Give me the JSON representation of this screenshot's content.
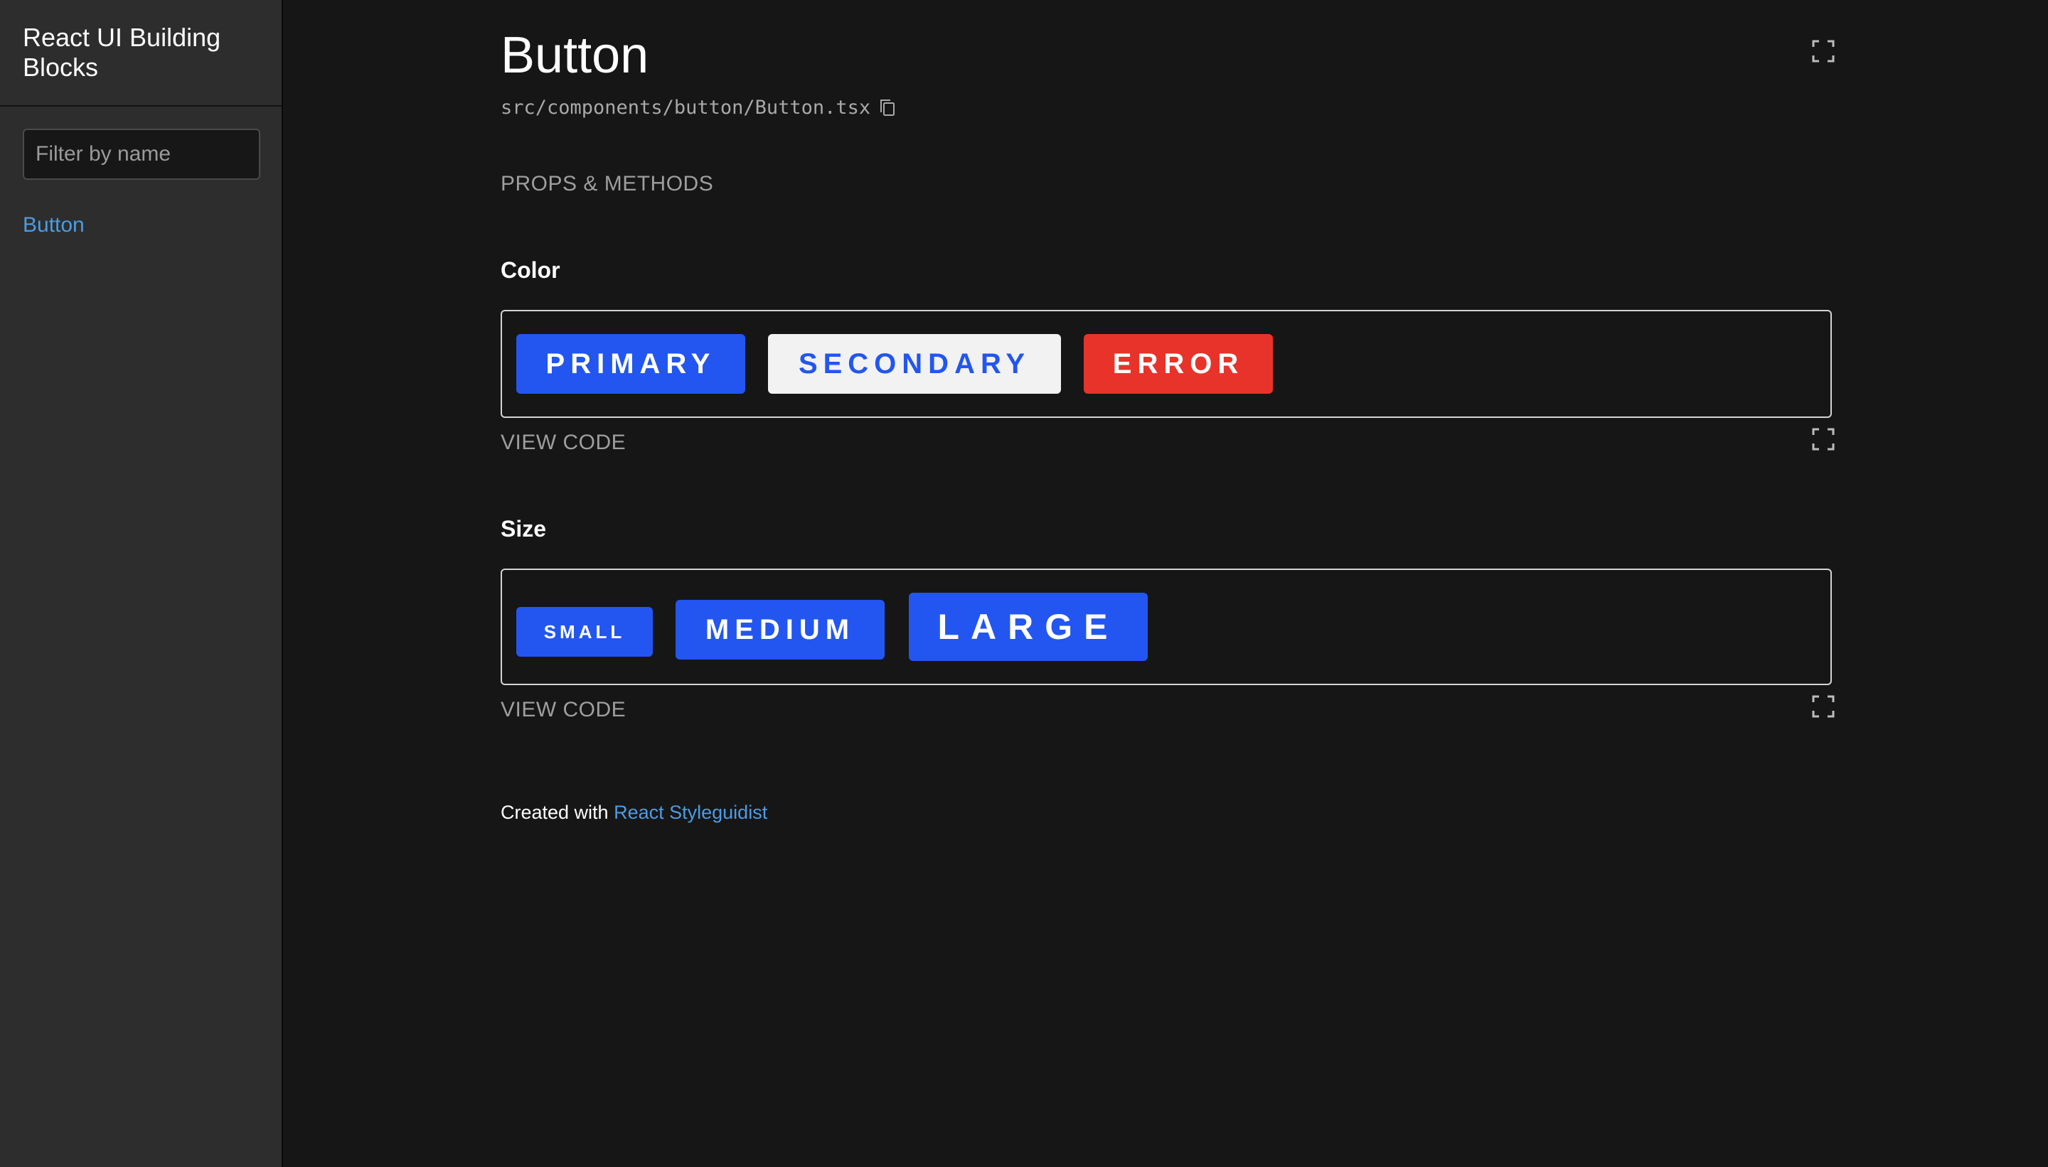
{
  "sidebar": {
    "title": "React UI Building Blocks",
    "filter_placeholder": "Filter by name",
    "items": [
      {
        "label": "Button"
      }
    ]
  },
  "main": {
    "title": "Button",
    "file_path": "src/components/button/Button.tsx",
    "props_methods_label": "PROPS & METHODS",
    "sections": [
      {
        "heading": "Color",
        "buttons": [
          "PRIMARY",
          "SECONDARY",
          "ERROR"
        ],
        "view_code_label": "VIEW CODE"
      },
      {
        "heading": "Size",
        "buttons": [
          "SMALL",
          "MEDIUM",
          "LARGE"
        ],
        "view_code_label": "VIEW CODE"
      }
    ]
  },
  "footer": {
    "prefix": "Created with",
    "link_text": "React Styleguidist"
  },
  "icons": {
    "fullscreen": "fullscreen-icon",
    "copy": "copy-icon"
  },
  "colors": {
    "primary": "#2356f0",
    "secondary_bg": "#f2f2f2",
    "error": "#e8332a",
    "link": "#4b9ce6",
    "sidebar_bg": "#2d2d2d",
    "main_bg": "#161616"
  }
}
